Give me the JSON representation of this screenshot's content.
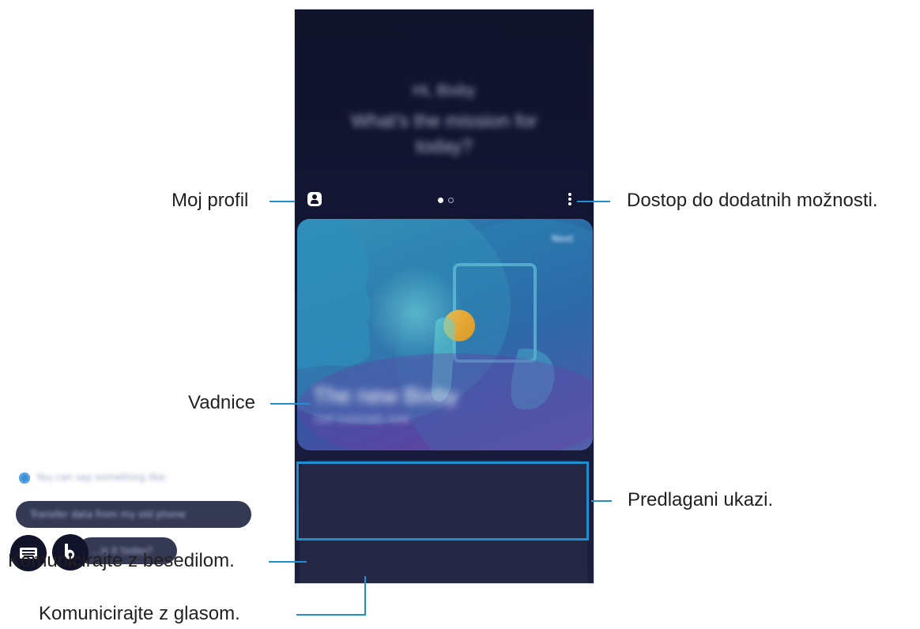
{
  "screen": {
    "greeting_line1": "Hi, Bixby",
    "greeting_line2": "What's the mission for",
    "greeting_line3": "today?",
    "page_indicator": {
      "count": 2,
      "active": 1
    },
    "tutorial_card": {
      "next_label": "Next",
      "title": "The new Bixby",
      "subtitle": "Get tutorials now"
    },
    "suggestions": {
      "header": "You can say something like:",
      "chip1": "Transfer data from my old phone",
      "chip2": "...is it today?"
    }
  },
  "callouts": {
    "profile": "Moj profil",
    "more_options": "Dostop do dodatnih možnosti.",
    "tutorials": "Vadnice",
    "suggested_commands": "Predlagani ukazi.",
    "text_input": "Komunicirajte z besedilom.",
    "voice_input": "Komunicirajte z glasom."
  },
  "colors": {
    "accent": "#1e8fd0",
    "screen_background": "#12152f",
    "label_text": "#231f20"
  },
  "icons": {
    "profile": "profile-icon",
    "more": "more-vertical-icon",
    "keyboard": "keyboard-icon",
    "voice": "bixby-voice-icon"
  }
}
